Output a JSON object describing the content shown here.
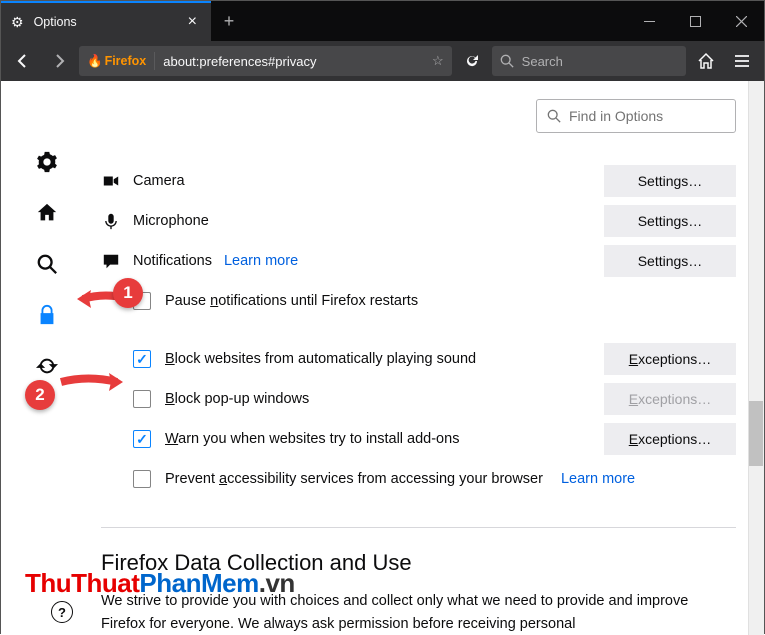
{
  "tab": {
    "title": "Options"
  },
  "url": {
    "identity": "Firefox",
    "text": "about:preferences#privacy"
  },
  "search_placeholder": "Search",
  "find_placeholder": "Find in Options",
  "permissions": {
    "camera": {
      "label": "Camera",
      "button": "Settings…"
    },
    "microphone": {
      "label": "Microphone",
      "button": "Settings…"
    },
    "notifications": {
      "label": "Notifications",
      "learn": "Learn more",
      "button": "Settings…"
    },
    "pause": {
      "label_pre": "Pause ",
      "label_u": "n",
      "label_post": "otifications until Firefox restarts",
      "checked": false
    },
    "block_sound": {
      "label_u": "B",
      "label_post": "lock websites from automatically playing sound",
      "checked": true,
      "button_u": "E",
      "button_post": "xceptions…"
    },
    "block_popup": {
      "label_u": "B",
      "label_post": "lock pop-up windows",
      "checked": false,
      "button_u": "E",
      "button_post": "xceptions…"
    },
    "warn_addons": {
      "label_u": "W",
      "label_post": "arn you when websites try to install add-ons",
      "checked": true,
      "button_u": "E",
      "button_post": "xceptions…"
    },
    "prevent_a11y": {
      "label_pre": "Prevent ",
      "label_u": "a",
      "label_post": "ccessibility services from accessing your browser",
      "learn": "Learn more",
      "checked": false
    }
  },
  "datacollection": {
    "title": "Firefox Data Collection and Use",
    "para": "We strive to provide you with choices and collect only what we need to provide and improve Firefox for everyone. We always ask permission before receiving personal"
  },
  "callouts": {
    "one": "1",
    "two": "2"
  },
  "watermark": {
    "a": "ThuThuat",
    "b": "PhanMem",
    "c": ".vn"
  }
}
